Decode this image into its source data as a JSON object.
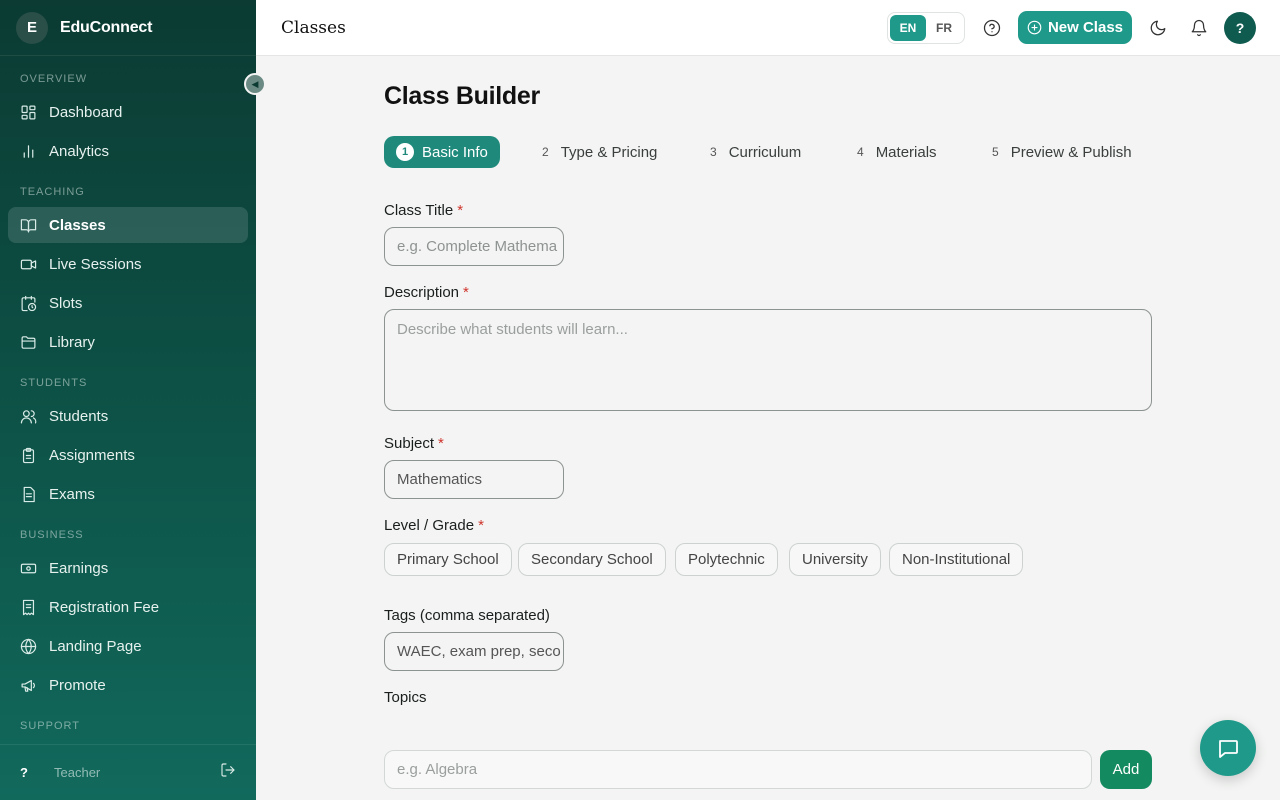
{
  "brand": {
    "initial": "E",
    "name": "EduConnect"
  },
  "sidebar": {
    "sections": [
      {
        "label": "OVERVIEW"
      },
      {
        "label": "TEACHING"
      },
      {
        "label": "STUDENTS"
      },
      {
        "label": "BUSINESS"
      },
      {
        "label": "SUPPORT"
      }
    ],
    "items": [
      {
        "label": "Dashboard",
        "icon": "dashboard-icon"
      },
      {
        "label": "Analytics",
        "icon": "analytics-icon"
      },
      {
        "label": "Classes",
        "icon": "book-icon",
        "active": true
      },
      {
        "label": "Live Sessions",
        "icon": "video-icon"
      },
      {
        "label": "Slots",
        "icon": "calendar-clock-icon"
      },
      {
        "label": "Library",
        "icon": "folder-icon"
      },
      {
        "label": "Students",
        "icon": "users-icon"
      },
      {
        "label": "Assignments",
        "icon": "clipboard-icon"
      },
      {
        "label": "Exams",
        "icon": "document-icon"
      },
      {
        "label": "Earnings",
        "icon": "money-icon"
      },
      {
        "label": "Registration Fee",
        "icon": "receipt-icon"
      },
      {
        "label": "Landing Page",
        "icon": "globe-icon"
      },
      {
        "label": "Promote",
        "icon": "megaphone-icon"
      }
    ],
    "footer": {
      "help": "?",
      "role": "Teacher"
    }
  },
  "topbar": {
    "page_name": "Classes",
    "languages": [
      "EN",
      "FR"
    ],
    "active_language": "EN",
    "new_class_label": "New Class",
    "avatar_initial": "?"
  },
  "main": {
    "title": "Class Builder",
    "steps": [
      {
        "num": "1",
        "label": "Basic Info"
      },
      {
        "num": "2",
        "label": "Type & Pricing"
      },
      {
        "num": "3",
        "label": "Curriculum"
      },
      {
        "num": "4",
        "label": "Materials"
      },
      {
        "num": "5",
        "label": "Preview & Publish"
      }
    ],
    "fields": {
      "class_title": {
        "label": "Class Title",
        "placeholder": "e.g. Complete Mathema"
      },
      "description": {
        "label": "Description",
        "placeholder": "Describe what students will learn..."
      },
      "subject": {
        "label": "Subject",
        "value": "Mathematics"
      },
      "level": {
        "label": "Level / Grade",
        "options": [
          "Primary School",
          "Secondary School",
          "Polytechnic",
          "University",
          "Non-Institutional"
        ]
      },
      "tags": {
        "label": "Tags (comma separated)",
        "placeholder": "WAEC, exam prep, seco"
      },
      "topics": {
        "label": "Topics",
        "placeholder": "e.g. Algebra",
        "add_label": "Add"
      }
    },
    "required_marker": "*"
  },
  "colors": {
    "accent": "#1f9a8a",
    "sidebar_dark": "#0b3b33",
    "add_button": "#138a5f",
    "required": "#d0342c"
  }
}
